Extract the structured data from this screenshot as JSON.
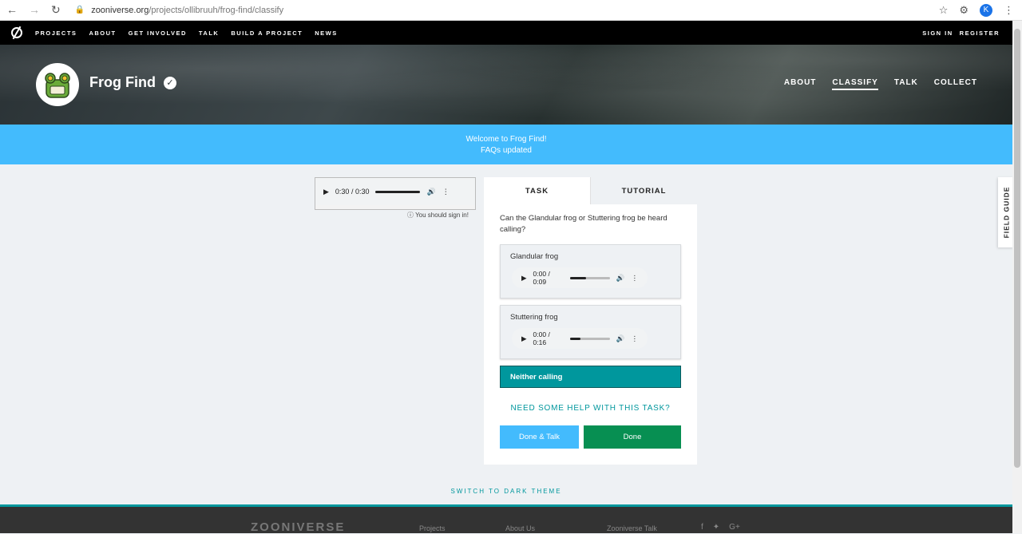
{
  "browser": {
    "url_host": "zooniverse.org",
    "url_path": "/projects/ollibruuh/frog-find/classify",
    "profile_initial": "K"
  },
  "topnav": {
    "links": [
      "PROJECTS",
      "ABOUT",
      "GET INVOLVED",
      "TALK",
      "BUILD A PROJECT",
      "NEWS"
    ],
    "sign_in": "SIGN IN",
    "register": "REGISTER"
  },
  "project": {
    "title": "Frog Find",
    "nav": [
      "ABOUT",
      "CLASSIFY",
      "TALK",
      "COLLECT"
    ],
    "active_nav": "CLASSIFY"
  },
  "banner": {
    "line1": "Welcome to Frog Find!",
    "line2": "FAQs updated"
  },
  "subject_player": {
    "time": "0:30 / 0:30",
    "sign_in_note": "You should sign in!"
  },
  "task_panel": {
    "tab_task": "TASK",
    "tab_tutorial": "TUTORIAL",
    "question": "Can the Glandular frog or Stuttering frog be heard calling?",
    "answers": [
      {
        "label": "Glandular frog",
        "time": "0:00 / 0:09",
        "progress": 0.4
      },
      {
        "label": "Stuttering frog",
        "time": "0:00 / 0:16",
        "progress": 0.25
      }
    ],
    "neither_label": "Neither calling",
    "help_text": "NEED SOME HELP WITH THIS TASK?",
    "done_talk": "Done & Talk",
    "done": "Done"
  },
  "field_guide": "FIELD GUIDE",
  "theme_switch": "SWITCH TO DARK THEME",
  "footer": {
    "brand": "ZOONIVERSE",
    "links": [
      "Projects",
      "About Us",
      "Zooniverse Talk"
    ]
  },
  "colors": {
    "teal": "#00979d",
    "banner_blue": "#43bbfd",
    "done_green": "#078f52"
  }
}
